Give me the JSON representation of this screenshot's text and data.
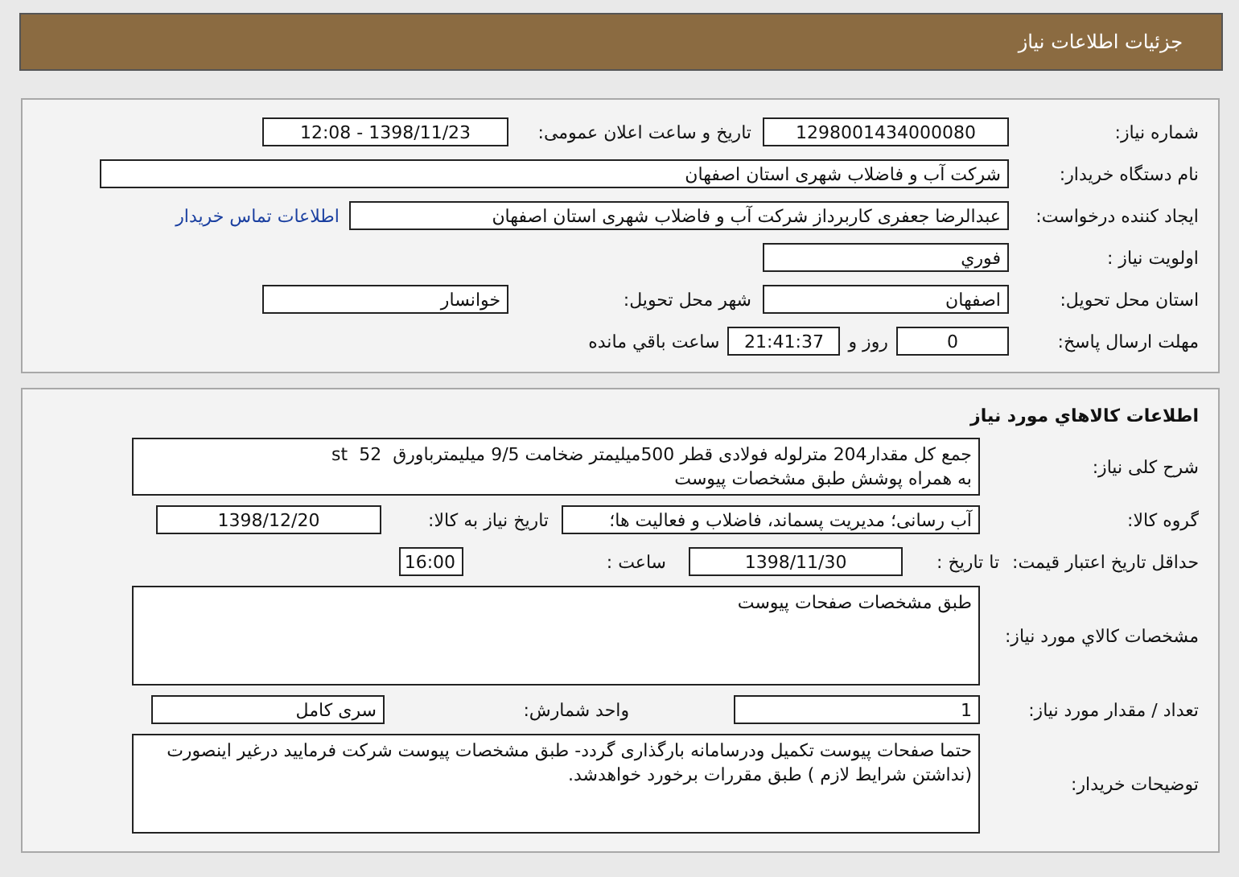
{
  "header": {
    "title": "جزئیات اطلاعات نیاز"
  },
  "need_number": {
    "label": "شماره نیاز:",
    "value": "1298001434000080"
  },
  "announce": {
    "label": "تاریخ و ساعت اعلان عمومی:",
    "value": "1398/11/23 - 12:08"
  },
  "buyer": {
    "label": "نام دستگاه خریدار:",
    "value": "شرکت آب و فاضلاب شهری استان اصفهان"
  },
  "requester": {
    "label": "ایجاد کننده درخواست:",
    "value": "عبدالرضا جعفری کاربرداز شرکت آب و فاضلاب شهری استان اصفهان",
    "contact_link": "اطلاعات تماس خریدار"
  },
  "priority": {
    "label": "اولویت نیاز :",
    "value": "فوري"
  },
  "province": {
    "label": "استان محل تحویل:",
    "value": "اصفهان"
  },
  "city": {
    "label": "شهر محل تحویل:",
    "value": "خوانسار"
  },
  "deadline": {
    "label": "مهلت ارسال پاسخ:",
    "days": "0",
    "days_suffix": "روز و",
    "time": "21:41:37",
    "time_suffix": "ساعت باقي مانده"
  },
  "goods": {
    "title": "اطلاعات کالاهاي مورد نیاز",
    "description": {
      "label": "شرح کلی نیاز:",
      "lines": [
        "جمع کل مقدار204 مترلوله فولادی قطر 500میلیمتر ضخامت 9/5 میلیمترباورق  st  52",
        "به همراه پوشش طبق مشخصات پیوست"
      ]
    },
    "group": {
      "label": "گروه کالا:",
      "value": "آب رسانی؛ مدیریت پسماند، فاضلاب و فعالیت ها؛"
    },
    "need_date": {
      "label": "تاریخ نیاز به کالا:",
      "value": "1398/12/20"
    },
    "price_validity": {
      "label": "حداقل تاریخ اعتبار قیمت:",
      "to_label": "تا تاریخ :",
      "date": "1398/11/30",
      "time_label": "ساعت :",
      "time": "16:00"
    },
    "specs": {
      "label": "مشخصات کالاي مورد نیاز:",
      "value": "طبق مشخصات صفحات پیوست"
    },
    "quantity": {
      "label": "تعداد / مقدار مورد نیاز:",
      "value": "1"
    },
    "unit": {
      "label": "واحد شمارش:",
      "value": "سری کامل"
    },
    "buyer_notes": {
      "label": "توضیحات خریدار:",
      "value": "حتما صفحات پیوست تکمیل ودرسامانه بارگذاری گردد- طبق مشخصات پیوست شرکت فرمایید درغیر اینصورت (نداشتن شرایط لازم ) طبق مقررات برخورد خواهدشد."
    }
  }
}
